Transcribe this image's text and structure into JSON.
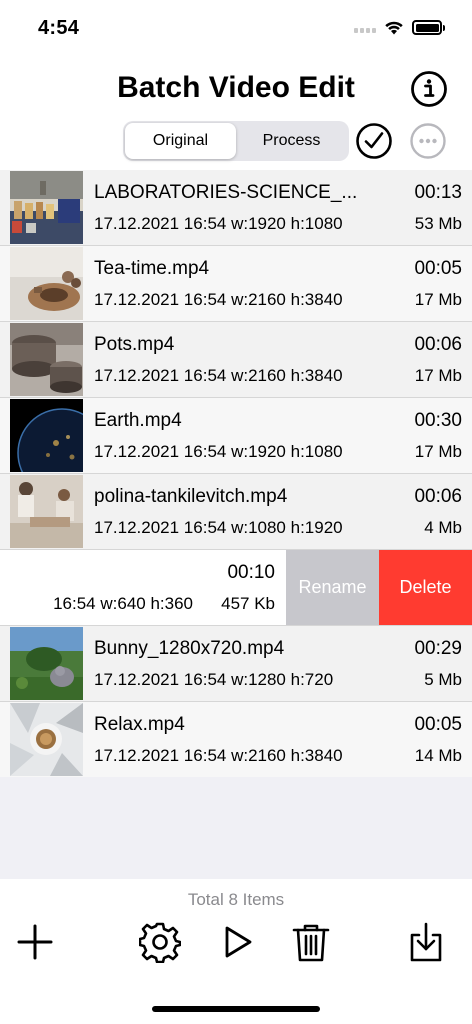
{
  "status_bar": {
    "time": "4:54"
  },
  "header": {
    "title": "Batch Video Edit",
    "segments": [
      {
        "label": "Original",
        "active": true
      },
      {
        "label": "Process",
        "active": false
      }
    ],
    "icons": {
      "info": "info-icon",
      "check": "checkmark-circle-icon",
      "more": "ellipsis-circle-icon"
    }
  },
  "videos": [
    {
      "name": "LABORATORIES-SCIENCE_...",
      "duration": "00:13",
      "meta": "17.12.2021 16:54 w:1920 h:1080",
      "size": "53 Mb"
    },
    {
      "name": "Tea-time.mp4",
      "duration": "00:05",
      "meta": "17.12.2021 16:54 w:2160 h:3840",
      "size": "17 Mb"
    },
    {
      "name": "Pots.mp4",
      "duration": "00:06",
      "meta": "17.12.2021 16:54 w:2160 h:3840",
      "size": "17 Mb"
    },
    {
      "name": "Earth.mp4",
      "duration": "00:30",
      "meta": "17.12.2021 16:54 w:1920 h:1080",
      "size": "17 Mb"
    },
    {
      "name": "polina-tankilevitch.mp4",
      "duration": "00:06",
      "meta": "17.12.2021 16:54 w:1080 h:1920",
      "size": "4 Mb"
    },
    {
      "name": "",
      "duration": "00:10",
      "meta": "16:54 w:640 h:360",
      "size": "457 Kb"
    },
    {
      "name": "Bunny_1280x720.mp4",
      "duration": "00:29",
      "meta": "17.12.2021 16:54 w:1280 h:720",
      "size": "5 Mb"
    },
    {
      "name": "Relax.mp4",
      "duration": "00:05",
      "meta": "17.12.2021 16:54 w:2160 h:3840",
      "size": "14 Mb"
    }
  ],
  "swipe_actions": {
    "rename": "Rename",
    "delete": "Delete"
  },
  "colors": {
    "delete": "#ff3b30",
    "rename": "#c7c7cc",
    "segment_bg": "#e5e5ea"
  },
  "footer": {
    "total": "Total 8 Items",
    "icons": [
      "plus-icon",
      "gear-icon",
      "play-icon",
      "trash-icon",
      "download-icon"
    ]
  }
}
